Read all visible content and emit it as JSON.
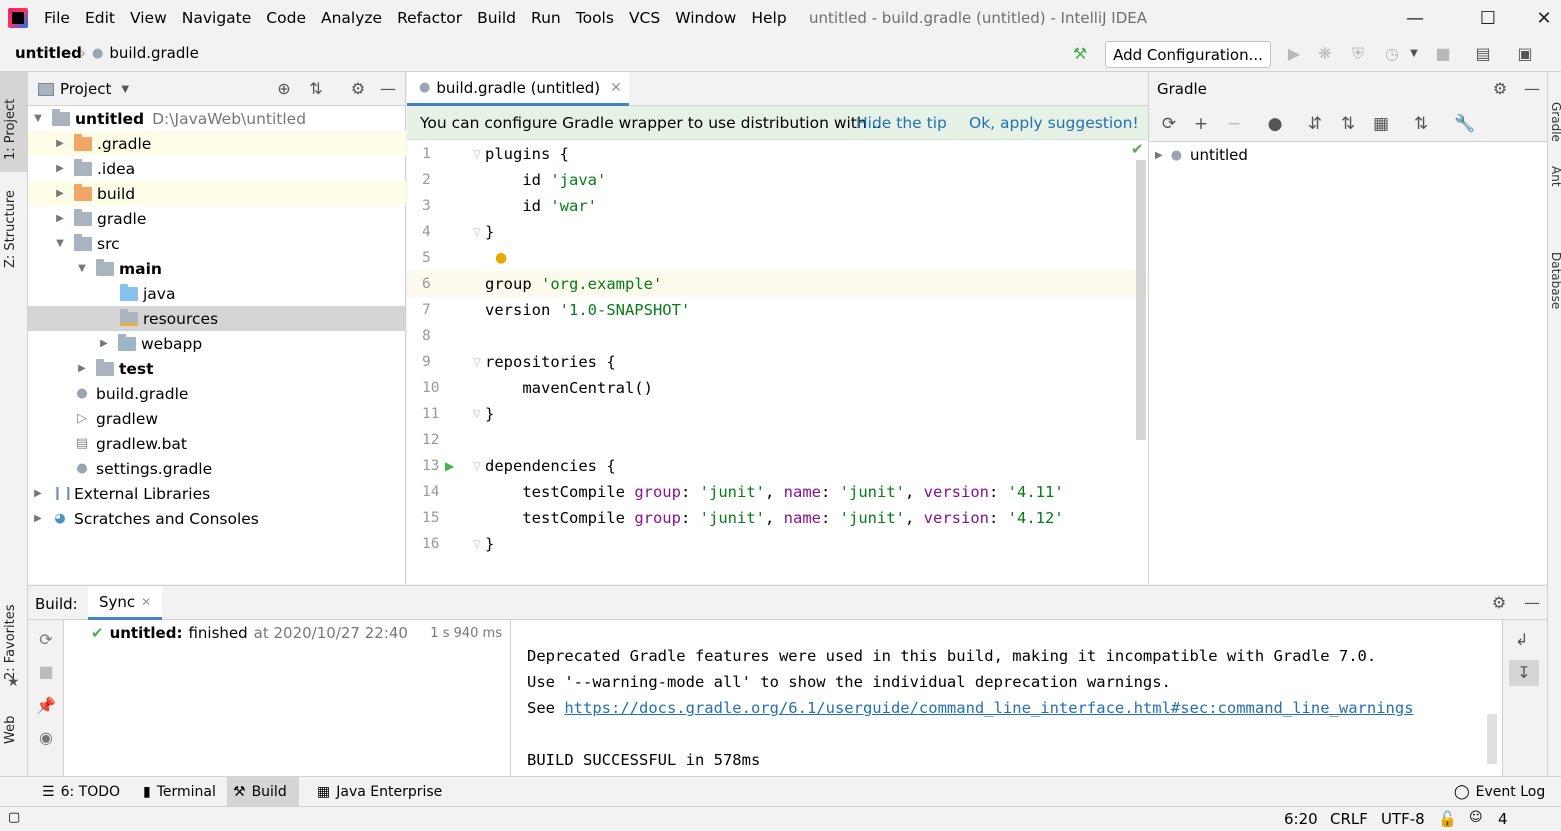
{
  "menubar": {
    "items": [
      "File",
      "Edit",
      "View",
      "Navigate",
      "Code",
      "Analyze",
      "Refactor",
      "Build",
      "Run",
      "Tools",
      "VCS",
      "Window",
      "Help"
    ],
    "window_title": "untitled - build.gradle (untitled) - IntelliJ IDEA"
  },
  "navbar": {
    "project": "untitled",
    "file": "build.gradle",
    "add_configuration": "Add Configuration..."
  },
  "left_stripe": {
    "project": "1: Project",
    "structure": "Z: Structure",
    "favorites": "2: Favorites",
    "web": "Web"
  },
  "right_stripe": {
    "gradle": "Gradle",
    "ant": "Ant",
    "database": "Database"
  },
  "project_panel": {
    "title": "Project",
    "tree": [
      {
        "label": "untitled",
        "path": "D:\\JavaWeb\\untitled"
      },
      {
        "label": ".gradle"
      },
      {
        "label": ".idea"
      },
      {
        "label": "build"
      },
      {
        "label": "gradle"
      },
      {
        "label": "src"
      },
      {
        "label": "main"
      },
      {
        "label": "java"
      },
      {
        "label": "resources"
      },
      {
        "label": "webapp"
      },
      {
        "label": "test"
      },
      {
        "label": "build.gradle"
      },
      {
        "label": "gradlew"
      },
      {
        "label": "gradlew.bat"
      },
      {
        "label": "settings.gradle"
      },
      {
        "label": "External Libraries"
      },
      {
        "label": "Scratches and Consoles"
      }
    ]
  },
  "editor": {
    "tab": "build.gradle (untitled)",
    "tip": {
      "text": "You can configure Gradle wrapper to use distribution with ..",
      "hide": "Hide the tip",
      "apply": "Ok, apply suggestion!"
    },
    "lines": [
      {
        "n": "1",
        "parts": [
          [
            "plain",
            "plugins {"
          ]
        ]
      },
      {
        "n": "2",
        "parts": [
          [
            "plain",
            "    id "
          ],
          [
            "str",
            "'java'"
          ]
        ]
      },
      {
        "n": "3",
        "parts": [
          [
            "plain",
            "    id "
          ],
          [
            "str",
            "'war'"
          ]
        ]
      },
      {
        "n": "4",
        "parts": [
          [
            "plain",
            "}"
          ]
        ]
      },
      {
        "n": "5",
        "parts": []
      },
      {
        "n": "6",
        "parts": [
          [
            "plain",
            "group "
          ],
          [
            "str",
            "'org.example'"
          ]
        ]
      },
      {
        "n": "7",
        "parts": [
          [
            "plain",
            "version "
          ],
          [
            "str",
            "'1.0-SNAPSHOT'"
          ]
        ]
      },
      {
        "n": "8",
        "parts": []
      },
      {
        "n": "9",
        "parts": [
          [
            "plain",
            "repositories {"
          ]
        ]
      },
      {
        "n": "10",
        "parts": [
          [
            "plain",
            "    mavenCentral()"
          ]
        ]
      },
      {
        "n": "11",
        "parts": [
          [
            "plain",
            "}"
          ]
        ]
      },
      {
        "n": "12",
        "parts": []
      },
      {
        "n": "13",
        "parts": [
          [
            "plain",
            "dependencies {"
          ]
        ]
      },
      {
        "n": "14",
        "parts": [
          [
            "plain",
            "    testCompile "
          ],
          [
            "kw",
            "group"
          ],
          [
            "plain",
            ": "
          ],
          [
            "str",
            "'junit'"
          ],
          [
            "plain",
            ", "
          ],
          [
            "kw",
            "name"
          ],
          [
            "plain",
            ": "
          ],
          [
            "str",
            "'junit'"
          ],
          [
            "plain",
            ", "
          ],
          [
            "kw",
            "version"
          ],
          [
            "plain",
            ": "
          ],
          [
            "str",
            "'4.11'"
          ]
        ]
      },
      {
        "n": "15",
        "parts": [
          [
            "plain",
            "    testCompile "
          ],
          [
            "kw",
            "group"
          ],
          [
            "plain",
            ": "
          ],
          [
            "str",
            "'junit'"
          ],
          [
            "plain",
            ", "
          ],
          [
            "kw",
            "name"
          ],
          [
            "plain",
            ": "
          ],
          [
            "str",
            "'junit'"
          ],
          [
            "plain",
            ", "
          ],
          [
            "kw",
            "version"
          ],
          [
            "plain",
            ": "
          ],
          [
            "str",
            "'4.12'"
          ]
        ]
      },
      {
        "n": "16",
        "parts": [
          [
            "plain",
            "}"
          ]
        ]
      }
    ]
  },
  "gradle_panel": {
    "title": "Gradle",
    "root": "untitled"
  },
  "build_panel": {
    "label": "Build:",
    "tab": "Sync",
    "item": {
      "name": "untitled:",
      "status": "finished",
      "time": "at 2020/10/27 22:40",
      "duration": "1 s 940 ms"
    },
    "console": {
      "line1": "Deprecated Gradle features were used in this build, making it incompatible with Gradle 7.0.",
      "line2": "Use '--warning-mode all' to show the individual deprecation warnings.",
      "line3_prefix": "See ",
      "line3_link": "https://docs.gradle.org/6.1/userguide/command_line_interface.html#sec:command_line_warnings",
      "line5": "BUILD SUCCESSFUL in 578ms"
    }
  },
  "bottom_tabs": {
    "todo": "6: TODO",
    "terminal": "Terminal",
    "build": "Build",
    "java_enterprise": "Java Enterprise",
    "event_log": "Event Log"
  },
  "status": {
    "position": "6:20",
    "line_sep": "CRLF",
    "encoding": "UTF-8",
    "indent": "4 spaces"
  },
  "colors": {
    "accent": "#4083c9",
    "string": "#067d17",
    "keyword": "#871094",
    "link": "#2470b3",
    "tip_bg": "#e6f2e6",
    "success": "#4caf50"
  }
}
